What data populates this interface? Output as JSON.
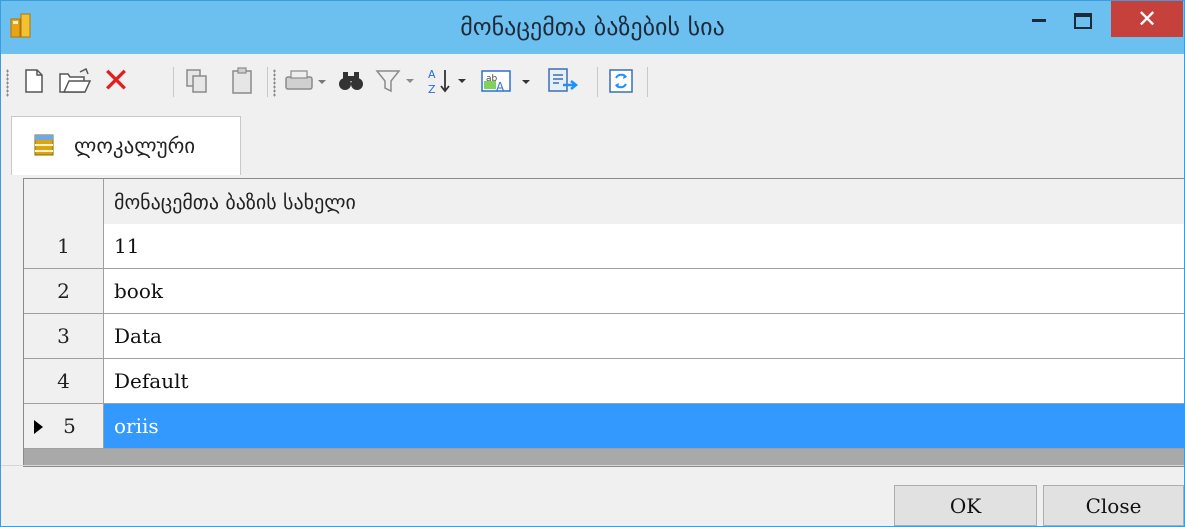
{
  "window": {
    "title": "მონაცემთა ბაზების სია",
    "close_glyph": "✕"
  },
  "toolbar": {
    "icons": [
      "new-icon",
      "open-icon",
      "delete-icon",
      "copy-icon",
      "paste-icon",
      "print-icon",
      "find-icon",
      "filter-icon",
      "sort-icon",
      "highlight-icon",
      "export-icon",
      "refresh-icon"
    ],
    "delete_glyph": "✕"
  },
  "tabs": [
    {
      "label": "ლოკალური"
    }
  ],
  "grid": {
    "column_header": "მონაცემთა ბაზის სახელი",
    "rows": [
      {
        "num": "1",
        "name": "11"
      },
      {
        "num": "2",
        "name": "book"
      },
      {
        "num": "3",
        "name": "Data"
      },
      {
        "num": "4",
        "name": "Default"
      },
      {
        "num": "5",
        "name": "oriis"
      }
    ]
  },
  "buttons": {
    "ok": "OK",
    "close": "Close"
  },
  "colors": {
    "titlebar": "#6cc0f0",
    "selection": "#3399ff",
    "close_button": "#c7413c"
  }
}
